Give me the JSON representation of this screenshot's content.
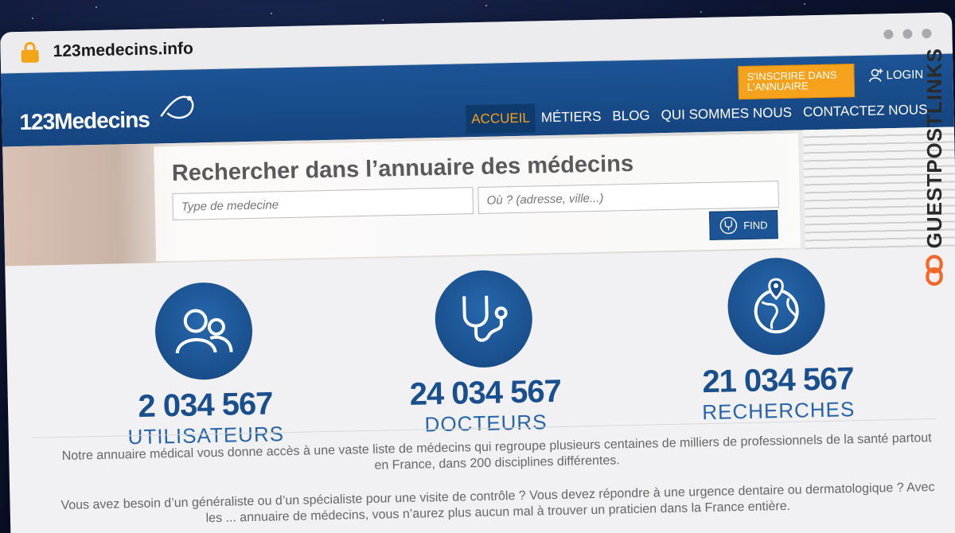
{
  "browser": {
    "url": "123medecins.info"
  },
  "header": {
    "logo_text": "123Medecins",
    "signup_label": "S'INSCRIRE DANS L'ANNUAIRE",
    "login_label": "LOGIN",
    "nav": [
      {
        "label": "ACCUEIL",
        "active": true
      },
      {
        "label": "MÉTIERS",
        "active": false
      },
      {
        "label": "BLOG",
        "active": false
      },
      {
        "label": "QUI SOMMES NOUS",
        "active": false
      },
      {
        "label": "CONTACTEZ NOUS",
        "active": false
      }
    ]
  },
  "search": {
    "title": "Rechercher dans l’annuaire des médecins",
    "type_placeholder": "Type de medecine",
    "location_placeholder": "Où ? (adresse, ville...)",
    "find_label": "FIND"
  },
  "stats": [
    {
      "icon": "users-icon",
      "number": "2 034 567",
      "label": "UTILISATEURS"
    },
    {
      "icon": "stethoscope-icon",
      "number": "24 034 567",
      "label": "DOCTEURS"
    },
    {
      "icon": "globe-pin-icon",
      "number": "21 034 567",
      "label": "RECHERCHES"
    }
  ],
  "description": [
    "Notre annuaire médical vous donne accès à une vaste liste de médecins qui regroupe plusieurs centaines de milliers de professionnels de la santé partout en France, dans 200 disciplines différentes.",
    "Vous avez besoin d’un généraliste ou d’un spécialiste pour une visite de contrôle ? Vous devez répondre à une urgence dentaire ou dermatologique ? Avec les ... annuaire de médecins, vous n’aurez plus aucun mal à trouver un praticien dans la France entière."
  ],
  "watermark": {
    "text": "GUESTPOSTLINKS"
  },
  "colors": {
    "brand_blue": "#1c5496",
    "accent_orange": "#f7a21c"
  }
}
